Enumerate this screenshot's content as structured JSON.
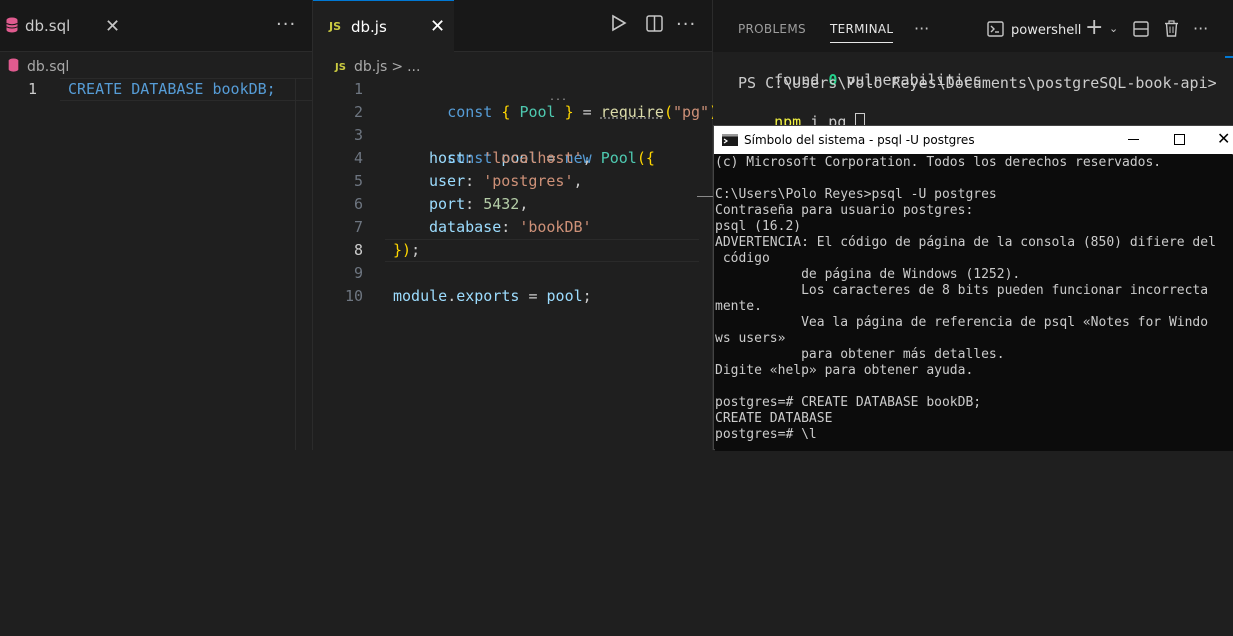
{
  "left_editor": {
    "tab": {
      "name": "db.sql",
      "icon": "database-icon"
    },
    "breadcrumb": "db.sql",
    "lines": [
      {
        "num": "1",
        "text": "CREATE DATABASE bookDB;"
      }
    ]
  },
  "mid_editor": {
    "tab": {
      "name": "db.js",
      "badge": "JS"
    },
    "breadcrumb": {
      "file": "db.js",
      "sep": ">",
      "rest": "..."
    },
    "line_numbers": [
      "1",
      "2",
      "3",
      "4",
      "5",
      "6",
      "7",
      "8",
      "9",
      "10"
    ],
    "code": {
      "l1": {
        "kw": "const",
        "b1": "{",
        "name": "Pool",
        "b2": "}",
        "eq": "=",
        "fn": "require",
        "p1": "(",
        "str": "\"pg\"",
        "p2": ");"
      },
      "l3": {
        "kw": "const",
        "name": "pool",
        "eq": "=",
        "new": "new",
        "cls": "Pool",
        "open": "({"
      },
      "l4": {
        "key": "host",
        "colon": ":",
        "val": "'localhost'",
        "comma": ","
      },
      "l5": {
        "key": "user",
        "colon": ":",
        "val": "'postgres'",
        "comma": ","
      },
      "l6": {
        "key": "port",
        "colon": ":",
        "val": "5432",
        "comma": ","
      },
      "l7": {
        "key": "database",
        "colon": ":",
        "val": "'bookDB'"
      },
      "l8": {
        "close": "})",
        "semi": ";"
      },
      "l10": {
        "mod": "module",
        "dot": ".",
        "exp": "exports",
        "eq": "=",
        "name": "pool",
        "semi": ";"
      }
    },
    "ellipsis": "..."
  },
  "panel": {
    "tabs": [
      "PROBLEMS",
      "TERMINAL"
    ],
    "shell": "powershell",
    "terminal_lines": [
      {
        "pre": "found ",
        "num": "0",
        "post": " vulnerabilities"
      },
      {
        "text": "PS C:\\Users\\Polo Reyes\\Documents\\postgreSQL-book-api>"
      },
      {
        "cmd": "npm",
        "rest": " i pg "
      }
    ]
  },
  "cmd_window": {
    "title": "Símbolo del sistema - psql  -U postgres",
    "lines": [
      "(c) Microsoft Corporation. Todos los derechos reservados.",
      "",
      "C:\\Users\\Polo Reyes>psql -U postgres",
      "Contraseña para usuario postgres:",
      "psql (16.2)",
      "ADVERTENCIA: El código de página de la consola (850) difiere del",
      " código",
      "           de página de Windows (1252).",
      "           Los caracteres de 8 bits pueden funcionar incorrecta",
      "mente.",
      "           Vea la página de referencia de psql «Notes for Windo",
      "ws users»",
      "           para obtener más detalles.",
      "Digite «help» para obtener ayuda.",
      "",
      "postgres=# CREATE DATABASE bookDB;",
      "CREATE DATABASE",
      "postgres=# \\l"
    ]
  },
  "colors": {
    "accent": "#0078d4",
    "keyword": "#569cd6",
    "string": "#ce9178",
    "class": "#4ec9b0",
    "function": "#dcdcaa",
    "property": "#9cdcfe",
    "number": "#b5cea8"
  }
}
